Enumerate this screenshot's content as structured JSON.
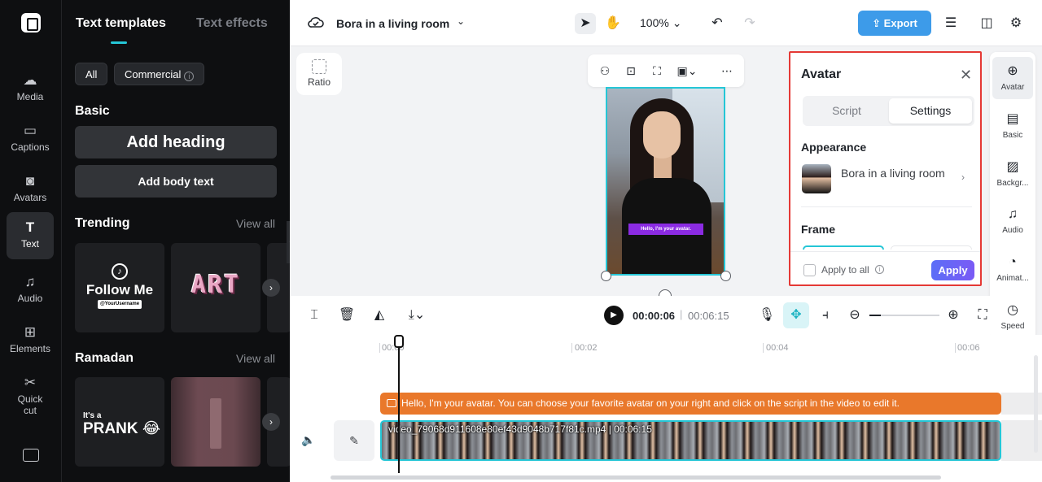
{
  "nav": {
    "items": [
      {
        "label": "Media",
        "icon": "cloud-upload-icon"
      },
      {
        "label": "Captions",
        "icon": "captions-icon"
      },
      {
        "label": "Avatars",
        "icon": "avatar-icon"
      },
      {
        "label": "Text",
        "icon": "text-icon"
      },
      {
        "label": "Audio",
        "icon": "music-icon"
      },
      {
        "label": "Elements",
        "icon": "elements-icon"
      },
      {
        "label": "Quick cut",
        "icon": "scissors-icon"
      }
    ]
  },
  "panel": {
    "tabs": [
      "Text templates",
      "Text effects"
    ],
    "filters": [
      "All",
      "Commercial"
    ],
    "basic_title": "Basic",
    "add_heading": "Add heading",
    "add_body": "Add body text",
    "trending_title": "Trending",
    "ramadan_title": "Ramadan",
    "view_all": "View all",
    "cards": {
      "follow_main": "Follow Me",
      "follow_sub": "@YourUsername",
      "art": "ART",
      "prank_small": "It's a",
      "prank_main": "PRANK 😂"
    }
  },
  "topbar": {
    "project_title": "Bora in a living room",
    "zoom": "100%",
    "export_label": "Export"
  },
  "canvas": {
    "ratio_label": "Ratio",
    "caption_text": "Hello, I'm your avatar."
  },
  "avatar_panel": {
    "title": "Avatar",
    "tabs": [
      "Script",
      "Settings"
    ],
    "active_tab": "Settings",
    "appearance_title": "Appearance",
    "avatar_name": "Bora in a living room",
    "frame_title": "Frame",
    "apply_all": "Apply to all",
    "apply": "Apply"
  },
  "rail": {
    "items": [
      "Avatar",
      "Basic",
      "Backgr...",
      "Audio",
      "Animat...",
      "Speed"
    ]
  },
  "timeline": {
    "current_time": "00:00:06",
    "separator": "|",
    "duration": "00:06:15",
    "ticks": [
      "00:00",
      "00:02",
      "00:04",
      "00:06"
    ],
    "text_clip": "Hello, I'm your avatar. You can choose your favorite avatar on your right and click on the script in the video to edit it.",
    "video_clip": "video_79068d911608e80ef43d9048b717f81c.mp4",
    "video_duration": "00:06:15"
  },
  "colors": {
    "accent": "#25c6d6",
    "export": "#3d9be9",
    "text_clip": "#e9782b",
    "highlight_border": "#e53935",
    "caption_bg": "#8b2be2"
  }
}
